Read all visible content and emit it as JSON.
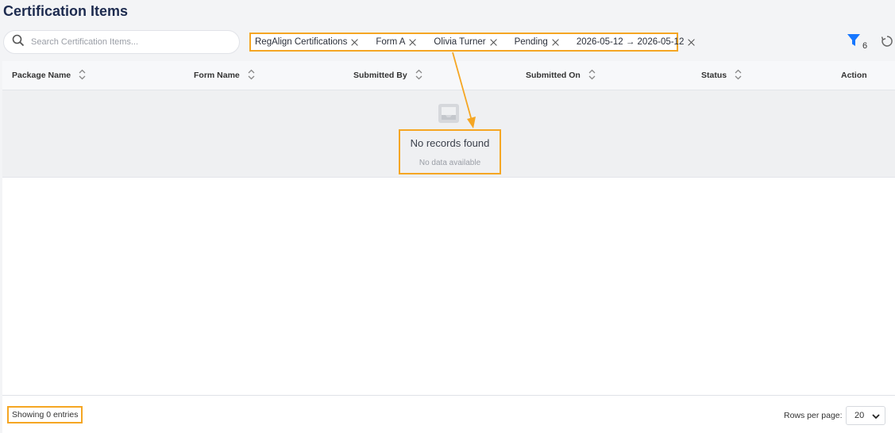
{
  "page": {
    "title": "Certification Items"
  },
  "search": {
    "placeholder": "Search Certification Items..."
  },
  "filters": {
    "chips": [
      "RegAlign Certifications",
      "Form A",
      "Olivia Turner",
      "Pending",
      "2026-05-12 → 2026-05-12"
    ],
    "count": "6"
  },
  "table": {
    "columns": [
      "Package Name",
      "Form Name",
      "Submitted By",
      "Submitted On",
      "Status",
      "Action"
    ]
  },
  "empty": {
    "title": "No records found",
    "subtitle": "No data available"
  },
  "footer": {
    "showing": "Showing 0 entries",
    "rows_label": "Rows per page:",
    "rows_value": "20"
  },
  "colors": {
    "accent": "#1677ff",
    "highlight": "#f5a623",
    "title": "#1d2b4f"
  },
  "icons": [
    "search-icon",
    "close-icon",
    "filter-icon",
    "reset-icon",
    "sort-icon",
    "inbox-icon",
    "chevron-down-icon"
  ]
}
